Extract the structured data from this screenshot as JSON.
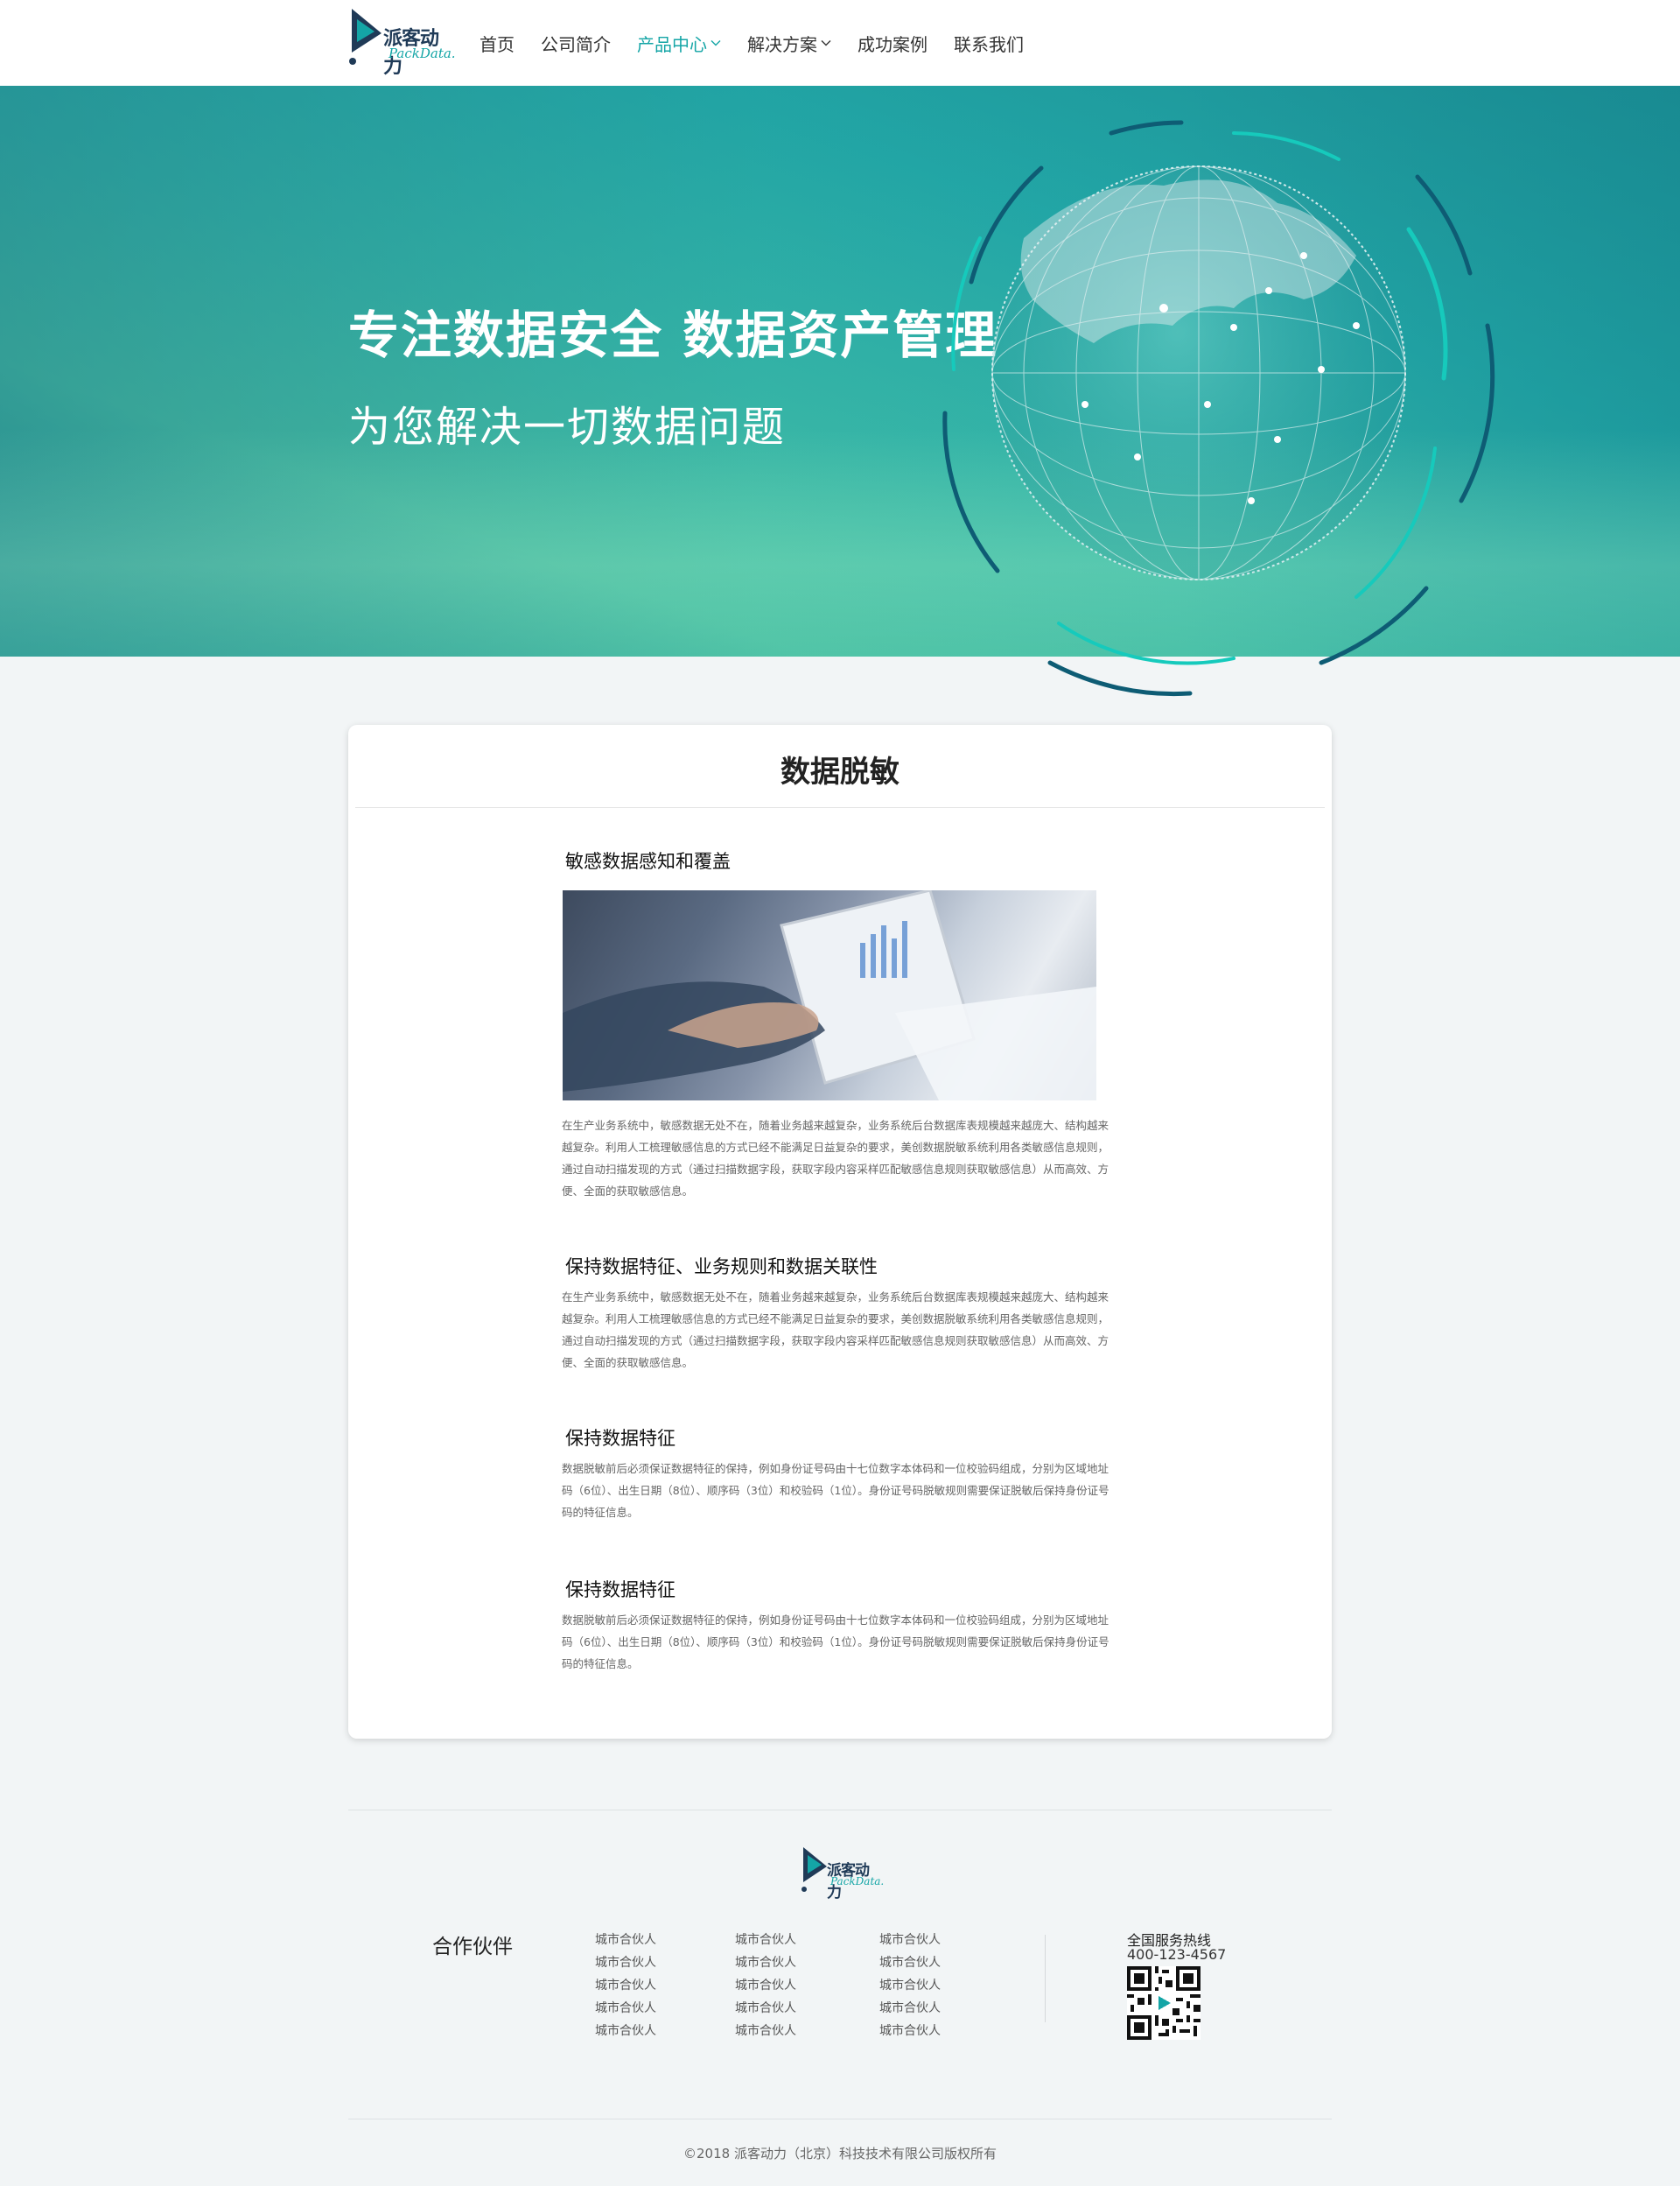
{
  "brand": {
    "name_cn": "派客动力",
    "name_en": "PackData."
  },
  "nav": {
    "items": [
      {
        "label": "首页",
        "active": false,
        "dropdown": false
      },
      {
        "label": "公司简介",
        "active": false,
        "dropdown": false
      },
      {
        "label": "产品中心",
        "active": true,
        "dropdown": true
      },
      {
        "label": "解决方案",
        "active": false,
        "dropdown": true
      },
      {
        "label": "成功案例",
        "active": false,
        "dropdown": false
      },
      {
        "label": "联系我们",
        "active": false,
        "dropdown": false
      }
    ]
  },
  "hero": {
    "title": "专注数据安全  数据资产管理",
    "subtitle": "为您解决一切数据问题"
  },
  "content": {
    "title": "数据脱敏",
    "sections": [
      {
        "heading": "敏感数据感知和覆盖",
        "body": "在生产业务系统中，敏感数据无处不在，随着业务越来越复杂，业务系统后台数据库表规模越来越庞大、结构越来越复杂。利用人工梳理敏感信息的方式已经不能满足日益复杂的要求，美创数据脱敏系统利用各类敏感信息规则，通过自动扫描发现的方式（通过扫描数据字段，获取字段内容采样匹配敏感信息规则获取敏感信息）从而高效、方便、全面的获取敏感信息。"
      },
      {
        "heading": "保持数据特征、业务规则和数据关联性",
        "body": "在生产业务系统中，敏感数据无处不在，随着业务越来越复杂，业务系统后台数据库表规模越来越庞大、结构越来越复杂。利用人工梳理敏感信息的方式已经不能满足日益复杂的要求，美创数据脱敏系统利用各类敏感信息规则，通过自动扫描发现的方式（通过扫描数据字段，获取字段内容采样匹配敏感信息规则获取敏感信息）从而高效、方便、全面的获取敏感信息。"
      },
      {
        "heading": "保持数据特征",
        "body": "数据脱敏前后必须保证数据特征的保持，例如身份证号码由十七位数字本体码和一位校验码组成，分别为区域地址码（6位）、出生日期（8位）、顺序码（3位）和校验码（1位）。身份证号码脱敏规则需要保证脱敏后保持身份证号码的特征信息。"
      },
      {
        "heading": "保持数据特征",
        "body": "数据脱敏前后必须保证数据特征的保持，例如身份证号码由十七位数字本体码和一位校验码组成，分别为区域地址码（6位）、出生日期（8位）、顺序码（3位）和校验码（1位）。身份证号码脱敏规则需要保证脱敏后保持身份证号码的特征信息。"
      }
    ]
  },
  "footer": {
    "partners_title": "合作伙伴",
    "partner_columns": [
      [
        "城市合伙人",
        "城市合伙人",
        "城市合伙人",
        "城市合伙人",
        "城市合伙人"
      ],
      [
        "城市合伙人",
        "城市合伙人",
        "城市合伙人",
        "城市合伙人",
        "城市合伙人"
      ],
      [
        "城市合伙人",
        "城市合伙人",
        "城市合伙人",
        "城市合伙人",
        "城市合伙人"
      ]
    ],
    "hotline_label": "全国服务热线",
    "hotline_number": "400-123-4567",
    "copyright": "©2018 派客动力（北京）科技技术有限公司版权所有"
  },
  "colors": {
    "accent": "#14a5a6",
    "brand_dark": "#1f3a57",
    "hero_teal": "#22a6a6"
  }
}
